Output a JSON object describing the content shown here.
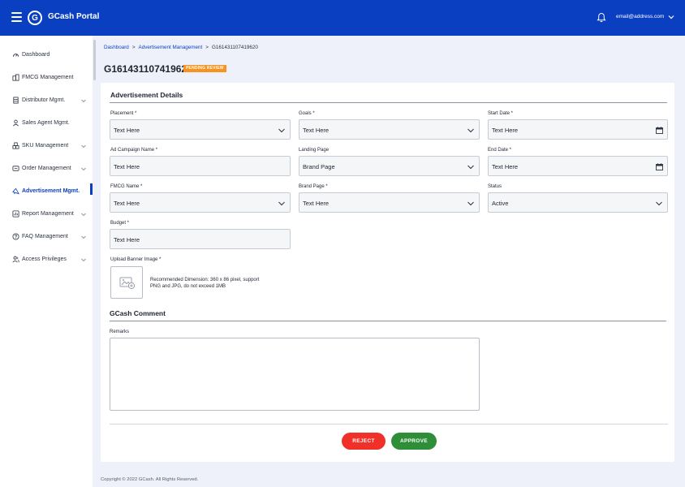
{
  "header": {
    "brand": "GCash Portal",
    "logo_letter": "G",
    "user_email": "email@address.com"
  },
  "sidebar": {
    "items": [
      {
        "label": "Dashboard",
        "icon": "gauge-icon",
        "has_chevron": false
      },
      {
        "label": "FMCG Management",
        "icon": "building-icon",
        "has_chevron": false
      },
      {
        "label": "Distributor Mgmt.",
        "icon": "warehouse-icon",
        "has_chevron": true
      },
      {
        "label": "Sales Agent Mgmt.",
        "icon": "user-icon",
        "has_chevron": false
      },
      {
        "label": "SKU Management",
        "icon": "boxes-icon",
        "has_chevron": true
      },
      {
        "label": "Order Management",
        "icon": "cart-icon",
        "has_chevron": true
      },
      {
        "label": "Advertisement Mgmt.",
        "icon": "megaphone-icon",
        "has_chevron": false,
        "active": true
      },
      {
        "label": "Report Management",
        "icon": "report-icon",
        "has_chevron": true
      },
      {
        "label": "FAQ Management",
        "icon": "question-icon",
        "has_chevron": true
      },
      {
        "label": "Access Privileges",
        "icon": "users-icon",
        "has_chevron": true
      }
    ]
  },
  "breadcrumb": {
    "items": [
      "Dashboard",
      "Advertisement Management",
      "G161431107419620"
    ],
    "separator": ">"
  },
  "page": {
    "title": "G161431107419620",
    "status_badge": "PENDING REVIEW"
  },
  "details": {
    "title": "Advertisement Details",
    "placement": {
      "label": "Placement *",
      "value": "Text Here"
    },
    "goals": {
      "label": "Goals *",
      "value": "Text Here"
    },
    "start_date": {
      "label": "Start Date *",
      "value": "Text Here"
    },
    "campaign_name": {
      "label": "Ad Campaign Name *",
      "value": "Text Here"
    },
    "landing_page": {
      "label": "Landing Page",
      "value": "Brand Page"
    },
    "end_date": {
      "label": "End Date *",
      "value": "Text Here"
    },
    "fmcg_name": {
      "label": "FMCG Name *",
      "value": "Text Here"
    },
    "brand_page": {
      "label": "Brand Page *",
      "value": "Text Here"
    },
    "status": {
      "label": "Status",
      "value": "Active"
    },
    "budget": {
      "label": "Budget *",
      "value": "Text Here"
    },
    "upload": {
      "label": "Upload Banner Image *",
      "note": "Recommended Dimension: 360 x 86 pixel, support PNG and JPG, do not exceed 1MB"
    }
  },
  "comment": {
    "title": "GCash Comment",
    "remarks_label": "Remarks",
    "remarks_value": ""
  },
  "actions": {
    "reject": "REJECT",
    "approve": "APPROVE"
  },
  "footer": {
    "copyright": "Copyright © 2022 GCash. All Rights Reserved."
  },
  "colors": {
    "primary": "#0b3fc2",
    "badge": "#f7931e",
    "reject": "#f2302a",
    "approve": "#2f8f39"
  }
}
